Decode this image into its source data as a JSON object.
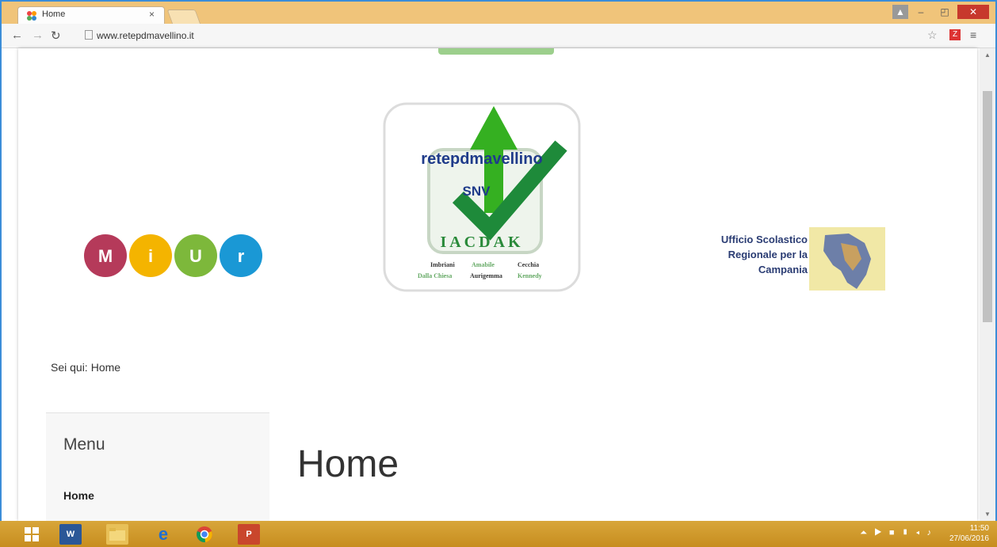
{
  "browser": {
    "tab_title": "Home",
    "tab_close": "×",
    "url": "www.retepdmavellino.it"
  },
  "logos": {
    "center_text": "retepdmavellino",
    "center_snv": "SNV",
    "center_school": "IACDAK",
    "center_names_row1": [
      "Imbriani",
      "Amabile",
      "Cecchia"
    ],
    "center_names_row2": [
      "Dalla Chiesa",
      "Aurigemma",
      "Kennedy"
    ],
    "usr_line1": "Ufficio Scolastico",
    "usr_line2": "Regionale per la",
    "usr_line3": "Campania",
    "miur_letters": [
      "M",
      "i",
      "U",
      "r"
    ]
  },
  "breadcrumb": {
    "prefix": "Sei qui:",
    "current": "Home"
  },
  "sidebar": {
    "heading": "Menu",
    "items": [
      "Home"
    ]
  },
  "main": {
    "title": "Home"
  },
  "clock": {
    "time": "11:50",
    "date": "27/06/2016"
  },
  "colors": {
    "titlebar": "#f0c47a",
    "taskbar": "#c78d1f",
    "miur": [
      "#b53a5a",
      "#f4b400",
      "#7db83b",
      "#1a98d5"
    ],
    "green": "#2e9b3b"
  }
}
